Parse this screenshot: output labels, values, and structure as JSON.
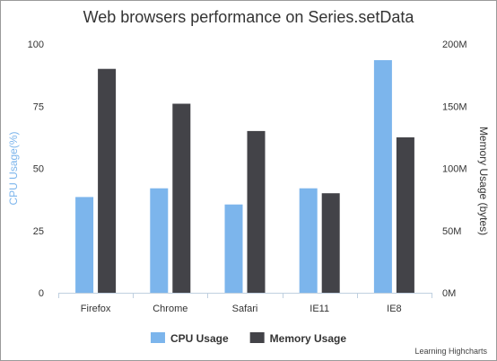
{
  "chart_data": {
    "type": "bar",
    "title": "Web browsers performance on Series.setData",
    "categories": [
      "Firefox",
      "Chrome",
      "Safari",
      "IE11",
      "IE8"
    ],
    "series": [
      {
        "name": "CPU Usage",
        "axis": "left",
        "color": "#7cb5ec",
        "values": [
          38.5,
          42,
          35.5,
          42,
          93.5
        ]
      },
      {
        "name": "Memory Usage",
        "axis": "right",
        "color": "#434348",
        "values": [
          180000000,
          152000000,
          130000000,
          80000000,
          125000000
        ]
      }
    ],
    "y_left": {
      "label": "CPU Usage(%)",
      "ylim": [
        0,
        100
      ],
      "ticks": [
        "0",
        "25",
        "50",
        "75",
        "100"
      ],
      "color": "#7cb5ec"
    },
    "y_right": {
      "label": "Memory Usage (bytes)",
      "ylim": [
        0,
        200000000
      ],
      "ticks": [
        "0M",
        "50M",
        "100M",
        "150M",
        "200M"
      ],
      "color": "#333333"
    },
    "legend_placement": "bottom-center",
    "grid": false,
    "credits": "Learning Highcharts"
  }
}
